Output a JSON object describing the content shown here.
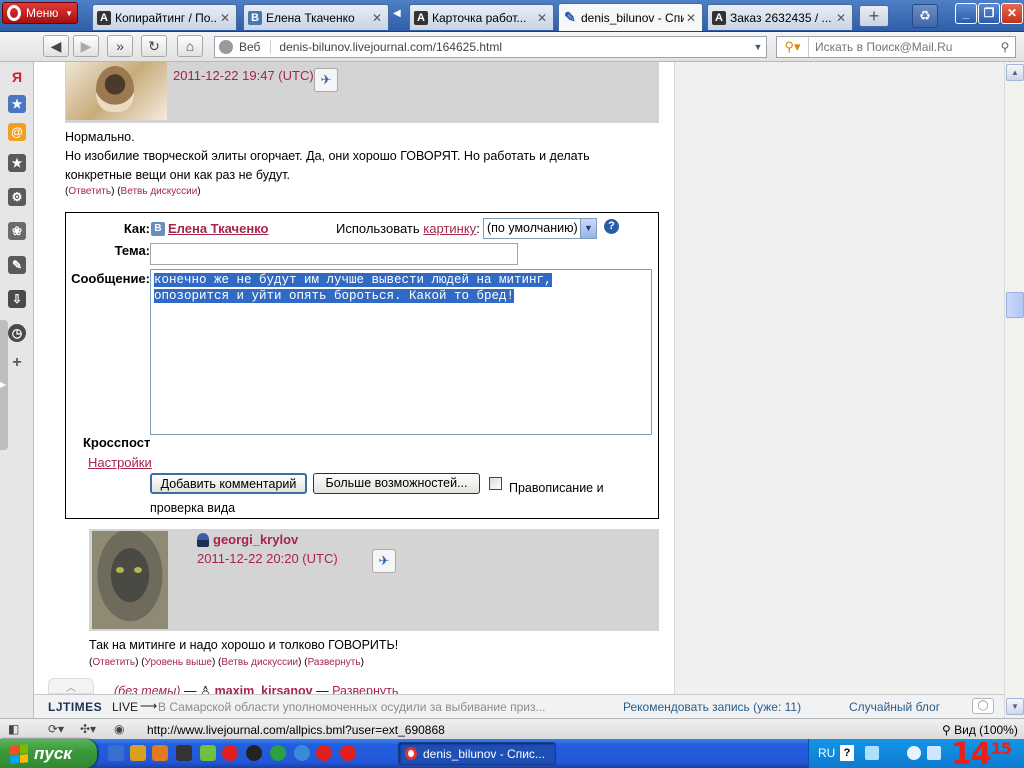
{
  "browser": {
    "menu_label": "Меню",
    "tabs": [
      {
        "label": "Копирайтинг / По...",
        "favicon": "A"
      },
      {
        "label": "Елена Ткаченко",
        "favicon": "B"
      },
      {
        "label": "Карточка работ...",
        "favicon": "A"
      },
      {
        "label": "denis_bilunov - Спи...",
        "favicon": "lj"
      },
      {
        "label": "Заказ 2632435 / ...",
        "favicon": "A"
      }
    ],
    "active_tab_index": 3,
    "address": {
      "prefix": "Веб",
      "url": "denis-bilunov.livejournal.com/164625.html"
    },
    "search": {
      "placeholder": "Искать в Поиск@Mail.Ru"
    },
    "colors": {
      "tabbar": "#2f5ea9",
      "accent_link": "#a6254a"
    }
  },
  "comment1": {
    "date": "2011-12-22 19:47 (UTC)",
    "text": [
      "Нормально.",
      "Но изобилие творческой элиты огорчает. Да, они хорошо ГОВОРЯТ. Но работать и делать",
      "конкретные вещи они как раз не будут."
    ],
    "links": {
      "reply": "Ответить",
      "thread": "Ветвь дискуссии"
    }
  },
  "reply_form": {
    "as_label": "Как:",
    "user_name": "Елена Ткаченко",
    "use_picture_label": "Использовать",
    "picture_link": "картинку",
    "picture_select_value": "(по умолчанию)",
    "subject_label": "Тема:",
    "subject_value": "",
    "message_label": "Сообщение:",
    "message_lines": [
      "конечно же не будут им лучше вывести людей на митинг,",
      "опозорится и уйти опять бороться. Какой то бред!"
    ],
    "crosspost_label": "Кросспост",
    "settings_link": "Настройки",
    "submit_label": "Добавить комментарий",
    "more_label": "Больше возможностей...",
    "spellcheck_label": "Правописание и проверка вида"
  },
  "comment2": {
    "user": "georgi_krylov",
    "date": "2011-12-22 20:20 (UTC)",
    "text": "Так на митинге и надо хорошо и толково ГОВОРИТЬ!",
    "links": {
      "reply": "Ответить",
      "parent": "Уровень выше",
      "thread": "Ветвь дискуссии",
      "expand": "Развернуть"
    }
  },
  "comment3": {
    "subject": "(без темы)",
    "dash": "—",
    "user": "maxim_kirsanov",
    "expand": "Развернуть"
  },
  "ljtimes": {
    "logo": "LJTIMES",
    "live": "LIVE",
    "arrow": "⟶",
    "headline": "В Самарской области уполномоченных осудили за выбивание приз...",
    "recommend": "Рекомендовать запись (уже: 11)",
    "random_blog": "Случайный блог"
  },
  "statusbar": {
    "url": "http://www.livejournal.com/allpics.bml?user=ext_690868",
    "zoom": "Вид (100%)"
  },
  "taskbar": {
    "start_label": "пуск",
    "task_label": "denis_bilunov - Спис...",
    "lang": "RU",
    "clock_hour": "14",
    "clock_minute": "15"
  }
}
